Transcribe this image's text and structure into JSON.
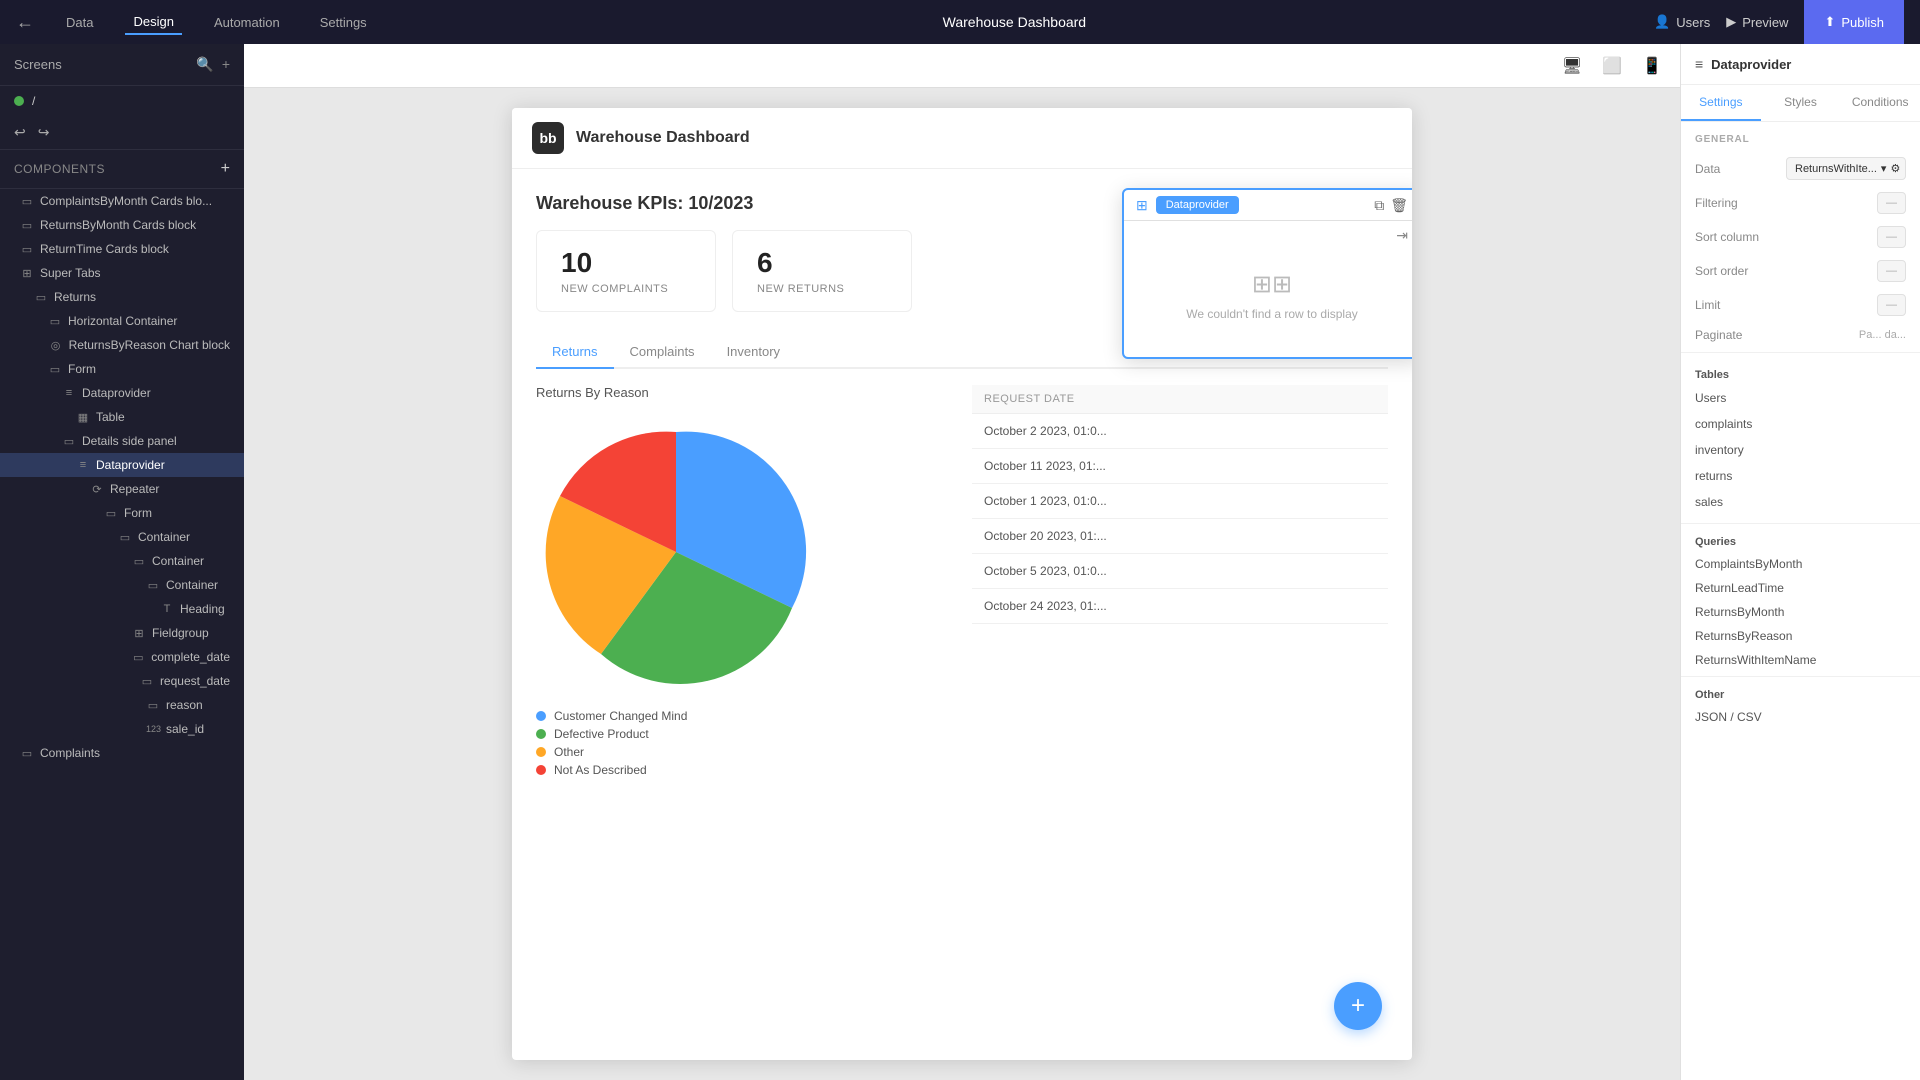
{
  "topNav": {
    "backIcon": "←",
    "navItems": [
      "Data",
      "Design",
      "Automation",
      "Settings"
    ],
    "activeNav": "Design",
    "title": "Warehouse Dashboard",
    "rightActions": {
      "users": "Users",
      "preview": "Preview",
      "publish": "Publish"
    }
  },
  "leftSidebar": {
    "screensTitle": "Screens",
    "screenItem": "/",
    "toolbarIcons": [
      "↩",
      "↪"
    ],
    "componentsTitle": "Components",
    "treeItems": [
      {
        "id": "complaints-by-month",
        "label": "ComplaintsByMonth Cards blo...",
        "indent": 0,
        "icon": "▭"
      },
      {
        "id": "returns-by-month",
        "label": "ReturnsByMonth Cards block",
        "indent": 0,
        "icon": "▭"
      },
      {
        "id": "return-time",
        "label": "ReturnTime Cards block",
        "indent": 0,
        "icon": "▭"
      },
      {
        "id": "super-tabs",
        "label": "Super Tabs",
        "indent": 0,
        "icon": "⊞"
      },
      {
        "id": "returns",
        "label": "Returns",
        "indent": 1,
        "icon": "▭"
      },
      {
        "id": "horizontal-container",
        "label": "Horizontal Container",
        "indent": 2,
        "icon": "▭"
      },
      {
        "id": "returns-by-reason-chart",
        "label": "ReturnsByReason Chart block",
        "indent": 3,
        "icon": "◎"
      },
      {
        "id": "form",
        "label": "Form",
        "indent": 2,
        "icon": "▭"
      },
      {
        "id": "dataprovider",
        "label": "Dataprovider",
        "indent": 3,
        "icon": "≡",
        "selected": false
      },
      {
        "id": "table",
        "label": "Table",
        "indent": 4,
        "icon": "▦"
      },
      {
        "id": "details-side-panel",
        "label": "Details side panel",
        "indent": 3,
        "icon": "▭"
      },
      {
        "id": "dataprovider-2",
        "label": "Dataprovider",
        "indent": 4,
        "icon": "≡",
        "selected": true
      },
      {
        "id": "repeater",
        "label": "Repeater",
        "indent": 5,
        "icon": "⟳"
      },
      {
        "id": "form-2",
        "label": "Form",
        "indent": 6,
        "icon": "▭"
      },
      {
        "id": "container-1",
        "label": "Container",
        "indent": 7,
        "icon": "▭"
      },
      {
        "id": "container-2",
        "label": "Container",
        "indent": 8,
        "icon": "▭"
      },
      {
        "id": "container-3",
        "label": "Container",
        "indent": 9,
        "icon": "▭"
      },
      {
        "id": "heading",
        "label": "Heading",
        "indent": 10,
        "icon": "T"
      },
      {
        "id": "fieldgroup",
        "label": "Fieldgroup",
        "indent": 8,
        "icon": "⊞"
      },
      {
        "id": "complete-date",
        "label": "complete_date",
        "indent": 9,
        "icon": "▭"
      },
      {
        "id": "request-date",
        "label": "request_date",
        "indent": 9,
        "icon": "▭"
      },
      {
        "id": "reason",
        "label": "reason",
        "indent": 9,
        "icon": "▭"
      },
      {
        "id": "sale-id",
        "label": "sale_id",
        "indent": 9,
        "icon": "123"
      }
    ],
    "complaints": {
      "id": "complaints-bottom",
      "label": "Complaints",
      "indent": 0,
      "icon": "▭"
    }
  },
  "canvas": {
    "viewIcons": [
      "desktop",
      "tablet",
      "mobile"
    ],
    "app": {
      "logoText": "bb",
      "headerTitle": "Warehouse Dashboard",
      "kpiTitle": "Warehouse KPIs: 10/2023",
      "kpiCards": [
        {
          "number": "10",
          "label": "NEW COMPLAINTS"
        },
        {
          "number": "6",
          "label": "NEW RETURNS"
        }
      ],
      "tabs": [
        "Returns",
        "Complaints",
        "Inventory"
      ],
      "activeTab": "Returns",
      "chartTitle": "Returns By Reason",
      "legend": [
        {
          "color": "#4a9eff",
          "label": "Customer Changed Mind"
        },
        {
          "color": "#4caf50",
          "label": "Defective Product"
        },
        {
          "color": "#ffa726",
          "label": "Other"
        },
        {
          "color": "#f44336",
          "label": "Not As Described"
        }
      ],
      "tableHeader": "REQUEST DATE",
      "tableRows": [
        "October 2 2023, 01:0...",
        "October 11 2023, 01:...",
        "October 1 2023, 01:0...",
        "October 20 2023, 01:...",
        "October 5 2023, 01:0...",
        "October 24 2023, 01:..."
      ]
    },
    "dataprovider": {
      "label": "Dataprovider",
      "emptyText": "We couldn't find a row to display"
    }
  },
  "rightPanel": {
    "title": "Dataprovider",
    "icon": "≡",
    "tabs": [
      "Settings",
      "Styles",
      "Conditions"
    ],
    "activeTab": "Settings",
    "sectionTitle": "GENERAL",
    "fields": [
      {
        "label": "Data",
        "value": "ReturnsWithIte..."
      },
      {
        "label": "Filtering",
        "value": ""
      },
      {
        "label": "Sort column",
        "value": ""
      },
      {
        "label": "Sort order",
        "value": ""
      },
      {
        "label": "Limit",
        "value": ""
      },
      {
        "label": "Paginate",
        "value": ""
      }
    ],
    "tables": {
      "header": "Tables",
      "items": [
        "Users",
        "complaints",
        "inventory",
        "returns",
        "sales"
      ]
    },
    "queries": {
      "header": "Queries",
      "items": [
        "ComplaintsByMonth",
        "ReturnLeadTime",
        "ReturnsByMonth",
        "ReturnsByReason",
        "ReturnsWithItemName"
      ]
    },
    "other": {
      "header": "Other",
      "items": [
        "JSON / CSV"
      ]
    }
  }
}
